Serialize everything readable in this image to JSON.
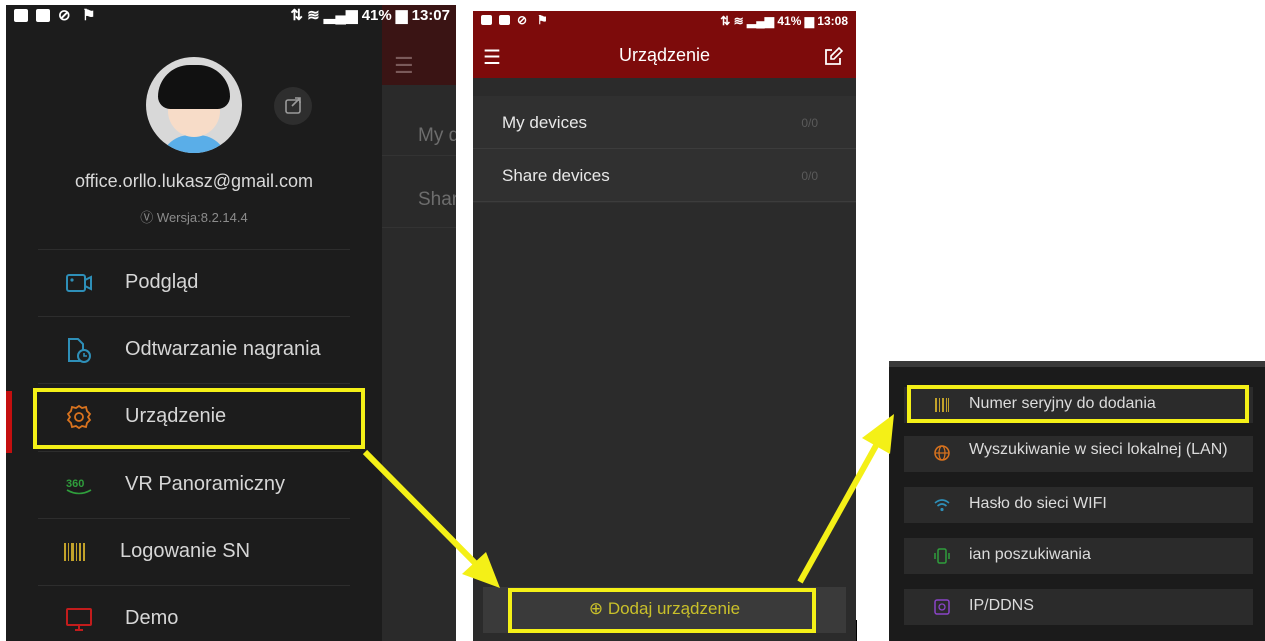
{
  "screen1": {
    "status": {
      "battery": "41%",
      "time": "13:07"
    },
    "email": "office.orllo.lukasz@gmail.com",
    "version": "Wersja:8.2.14.4",
    "menu": [
      {
        "label": "Podgląd",
        "icon": "camera-icon",
        "color": "#2e8fb8"
      },
      {
        "label": "Odtwarzanie nagrania",
        "icon": "playback-file-icon",
        "color": "#2e8fb8"
      },
      {
        "label": "Urządzenie",
        "icon": "gear-icon",
        "color": "#d9731e"
      },
      {
        "label": "VR Panoramiczny",
        "icon": "vr-360-icon",
        "color": "#2f9e3c"
      },
      {
        "label": "Logowanie SN",
        "icon": "barcode-icon",
        "color": "#c2a22a"
      },
      {
        "label": "Demo",
        "icon": "monitor-icon",
        "color": "#c21c1c"
      }
    ],
    "behind": {
      "row1": "My d",
      "row2": "Shar"
    }
  },
  "screen2": {
    "status": {
      "battery": "41%",
      "time": "13:08"
    },
    "title": "Urządzenie",
    "rows": [
      {
        "name": "My devices",
        "count": "0/0"
      },
      {
        "name": "Share devices",
        "count": "0/0"
      }
    ],
    "add_button": "⊕ Dodaj urządzenie",
    "accent": "#7d0b0b"
  },
  "screen3": {
    "options": [
      {
        "label": "Numer seryjny do dodania",
        "icon": "barcode-icon",
        "color": "#c2a22a"
      },
      {
        "label": "Wyszukiwanie w sieci lokalnej (LAN)",
        "icon": "globe-icon",
        "color": "#d9731e"
      },
      {
        "label": "Hasło do sieci WIFI",
        "icon": "wifi-icon",
        "color": "#2e8fb8"
      },
      {
        "label": "ian poszukiwania",
        "icon": "phone-vibrate-icon",
        "color": "#2f9e3c"
      },
      {
        "label": "IP/DDNS",
        "icon": "ip-icon",
        "color": "#8a44c8"
      }
    ]
  },
  "highlight_color": "#f4f017"
}
